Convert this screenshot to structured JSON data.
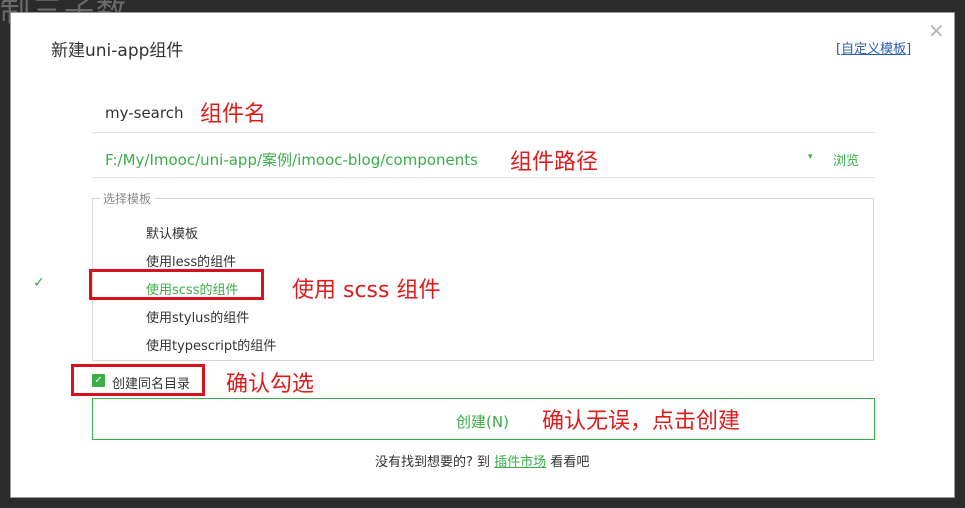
{
  "background_text": "制三子数",
  "dialog": {
    "title": "新建uni-app组件",
    "custom_link_open": "[",
    "custom_link_label": "自定义模板",
    "custom_link_close": "]",
    "close_glyph": "✕"
  },
  "name_field": {
    "value": "my-search",
    "annotation": "组件名"
  },
  "path_field": {
    "value": "F:/My/Imooc/uni-app/案例/imooc-blog/components",
    "dropdown_glyph": "▾",
    "browse_label": "浏览",
    "annotation": "组件路径"
  },
  "templates": {
    "legend": "选择模板",
    "items": [
      {
        "label": "默认模板"
      },
      {
        "label": "使用less的组件"
      },
      {
        "label": "使用scss的组件"
      },
      {
        "label": "使用stylus的组件"
      },
      {
        "label": "使用typescript的组件"
      }
    ],
    "selected_index": 2,
    "check_glyph": "✓",
    "annotation": "使用 scss 组件"
  },
  "checkbox": {
    "label": "创建同名目录",
    "checked": true,
    "check_glyph": "✓",
    "annotation": "确认勾选"
  },
  "create_button": {
    "label": "创建(N)",
    "annotation": "确认无误，点击创建"
  },
  "footer": {
    "prefix": "没有找到想要的? 到",
    "market_link": "插件市场",
    "suffix": "看看吧"
  },
  "colors": {
    "accent_green": "#3aae48",
    "annotation_red": "#e01b1b",
    "link_blue": "#2a5db0"
  }
}
